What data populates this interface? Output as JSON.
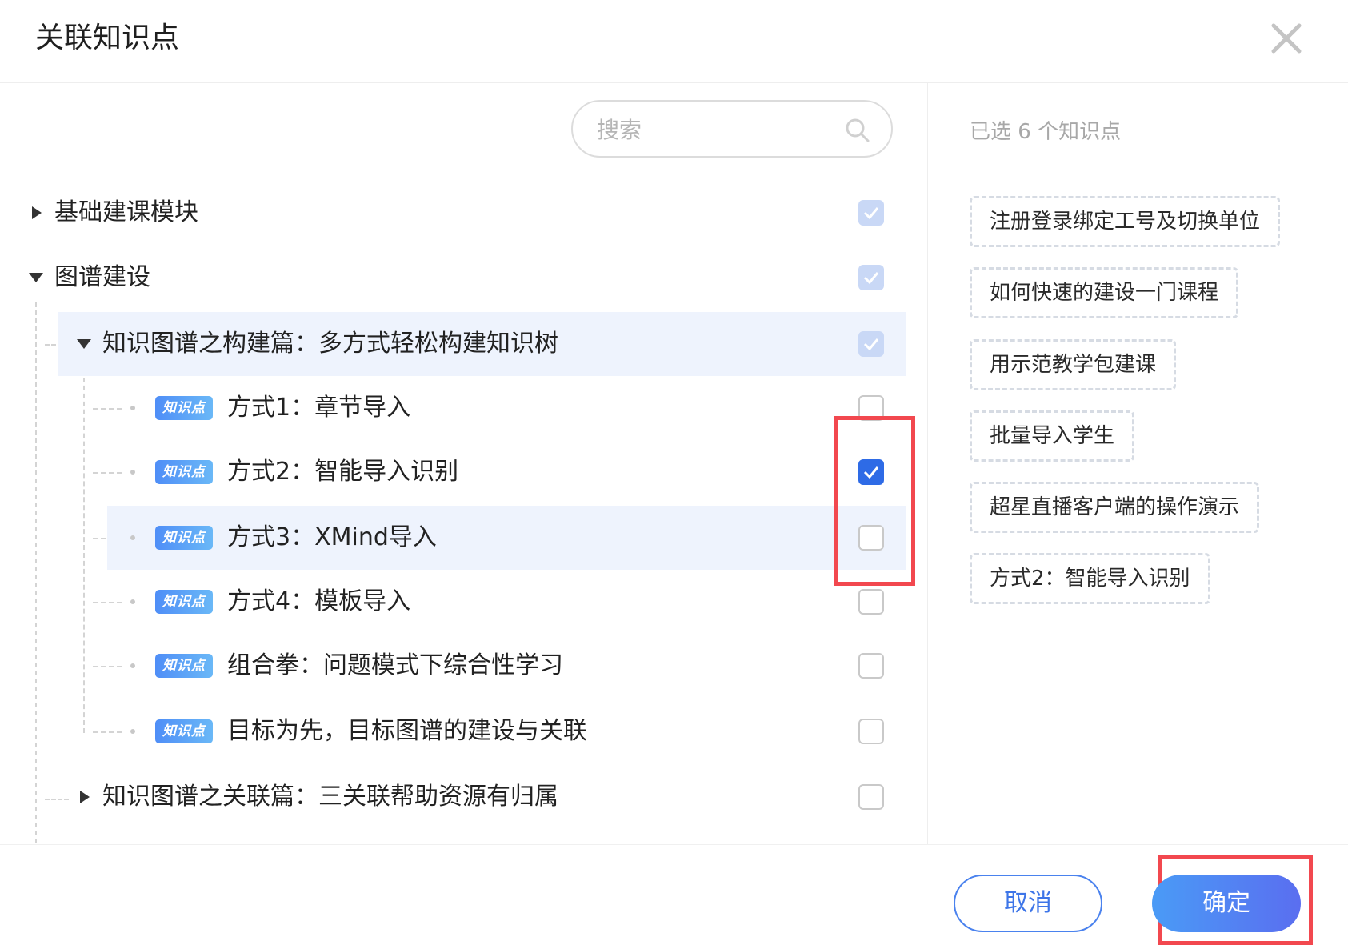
{
  "dialog": {
    "title": "关联知识点"
  },
  "search": {
    "placeholder": "搜索"
  },
  "tree": {
    "badge_label": "知识点",
    "nodes": [
      {
        "label": "基础建课模块",
        "expanded": false,
        "checked": "dim"
      },
      {
        "label": "图谱建设",
        "expanded": true,
        "checked": "dim"
      },
      {
        "label": "知识图谱之构建篇：多方式轻松构建知识树",
        "expanded": true,
        "checked": "dim"
      },
      {
        "label": "方式1：章节导入",
        "checked": "none"
      },
      {
        "label": "方式2：智能导入识别",
        "checked": "checked"
      },
      {
        "label": "方式3：XMind导入",
        "checked": "none"
      },
      {
        "label": "方式4：模板导入",
        "checked": "none"
      },
      {
        "label": "组合拳：问题模式下综合性学习",
        "checked": "none"
      },
      {
        "label": "目标为先，目标图谱的建设与关联",
        "checked": "none"
      },
      {
        "label": "知识图谱之关联篇：三关联帮助资源有归属",
        "expanded": false,
        "checked": "none"
      }
    ]
  },
  "selected": {
    "count_text": "已选 6 个知识点",
    "items": [
      "注册登录绑定工号及切换单位",
      "如何快速的建设一门课程",
      "用示范教学包建课",
      "批量导入学生",
      "超星直播客户端的操作演示",
      "方式2：智能导入识别"
    ]
  },
  "footer": {
    "cancel_label": "取消",
    "confirm_label": "确定"
  },
  "colors": {
    "accent": "#2e6be6",
    "annotation": "#f2484f",
    "row_highlight": "#eef3fd"
  }
}
